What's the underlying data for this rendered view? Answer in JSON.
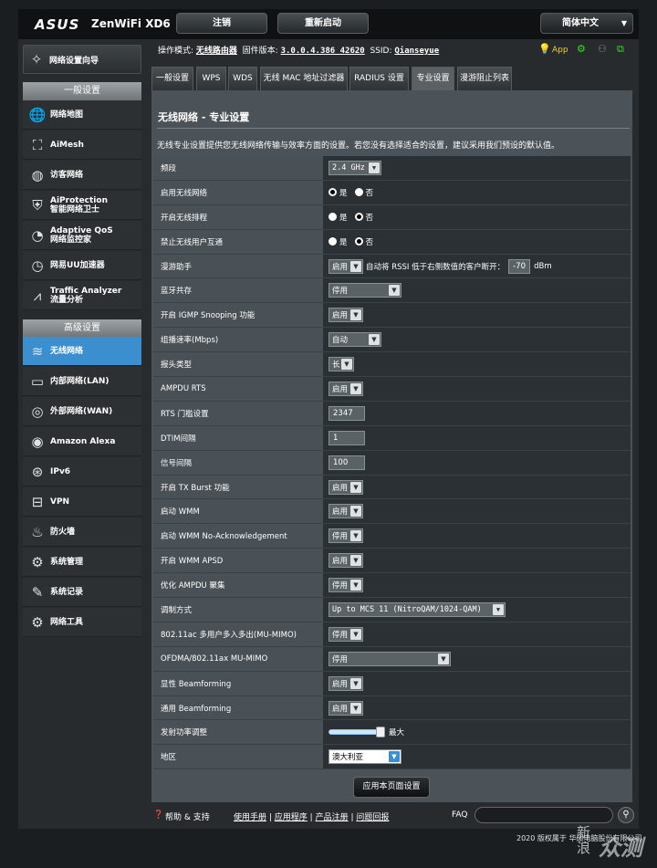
{
  "header": {
    "brand": "ASUS",
    "model": "ZenWiFi XD6",
    "logout": "注销",
    "reboot": "重新启动",
    "language": "简体中文",
    "app": "App"
  },
  "info": {
    "mode_label": "操作模式:",
    "mode": "无线路由器",
    "fw_label": "固件版本:",
    "fw": "3.0.0.4.386_42620",
    "ssid_label": "SSID:",
    "ssid": "Qianseyue"
  },
  "sidebar": {
    "wizard": "网络设置向导",
    "general_title": "一般设置",
    "general": [
      {
        "label": "网络地图",
        "icon": "globe-icon"
      },
      {
        "label": "AiMesh",
        "icon": "mesh-icon"
      },
      {
        "label": "访客网络",
        "icon": "guest-network-icon"
      },
      {
        "label": "AiProtection",
        "sub": "智能网络卫士",
        "icon": "shield-icon"
      },
      {
        "label": "Adaptive QoS",
        "sub": "网络监控家",
        "icon": "gauge-icon"
      },
      {
        "label": "网易UU加速器",
        "icon": "speed-icon"
      },
      {
        "label": "Traffic Analyzer",
        "sub": "流量分析",
        "icon": "traffic-icon"
      }
    ],
    "advanced_title": "高级设置",
    "advanced": [
      {
        "label": "无线网络",
        "icon": "wifi-icon"
      },
      {
        "label": "内部网络(LAN)",
        "icon": "lan-icon"
      },
      {
        "label": "外部网络(WAN)",
        "icon": "wan-globe-icon"
      },
      {
        "label": "Amazon Alexa",
        "icon": "alexa-icon"
      },
      {
        "label": "IPv6",
        "icon": "ipv6-icon"
      },
      {
        "label": "VPN",
        "icon": "vpn-icon"
      },
      {
        "label": "防火墙",
        "icon": "firewall-icon"
      },
      {
        "label": "系统管理",
        "icon": "admin-gear-icon"
      },
      {
        "label": "系统记录",
        "icon": "log-icon"
      },
      {
        "label": "网络工具",
        "icon": "tools-icon"
      }
    ]
  },
  "tabs": [
    "一般设置",
    "WPS",
    "WDS",
    "无线 MAC 地址过滤器",
    "RADIUS 设置",
    "专业设置",
    "漫游阻止列表"
  ],
  "page": {
    "title": "无线网络 - 专业设置",
    "desc": "无线专业设置提供您无线网络传输与效率方面的设置。若您没有选择适合的设置，建议采用我们预设的默认值。"
  },
  "radio": {
    "yes": "是",
    "no": "否"
  },
  "settings": [
    {
      "label": "频段",
      "type": "select",
      "value": "2.4 GHz",
      "mono": true,
      "w": 58
    },
    {
      "label": "启用无线网络",
      "type": "radio",
      "on": "yes"
    },
    {
      "label": "开启无线排程",
      "type": "radio",
      "on": "no"
    },
    {
      "label": "禁止无线用户互通",
      "type": "radio",
      "on": "no"
    },
    {
      "label": "漫游助手",
      "type": "roam",
      "value": "启用",
      "text": "自动将 RSSI 低于右侧数值的客户断开：",
      "rssi": "-70",
      "unit": "dBm"
    },
    {
      "label": "蓝牙共存",
      "type": "select",
      "value": "停用",
      "w": 80
    },
    {
      "label": "开启 IGMP Snooping 功能",
      "type": "select",
      "value": "启用",
      "w": 38
    },
    {
      "label": "组播速率(Mbps)",
      "type": "select",
      "value": "自动",
      "w": 58
    },
    {
      "label": "报头类型",
      "type": "select",
      "value": "长",
      "w": 28
    },
    {
      "label": "AMPDU RTS",
      "type": "select",
      "value": "启用",
      "w": 38
    },
    {
      "label": "RTS 门槛设置",
      "type": "input",
      "value": "2347"
    },
    {
      "label": "DTIM间隔",
      "type": "input",
      "value": "1"
    },
    {
      "label": "信号间隔",
      "type": "input",
      "value": "100"
    },
    {
      "label": "开启 TX Burst 功能",
      "type": "select",
      "value": "启用",
      "w": 38
    },
    {
      "label": "启动 WMM",
      "type": "select",
      "value": "启用",
      "w": 38
    },
    {
      "label": "启动 WMM No-Acknowledgement",
      "type": "select",
      "value": "停用",
      "w": 38
    },
    {
      "label": "开启 WMM APSD",
      "type": "select",
      "value": "启用",
      "w": 38
    },
    {
      "label": "优化 AMPDU 聚集",
      "type": "select",
      "value": "停用",
      "w": 38
    },
    {
      "label": "调制方式",
      "type": "select",
      "value": "Up to MCS 11 (NitroQAM/1024-QAM)",
      "mono": true,
      "w": 194
    },
    {
      "label": "802.11ac 多用户多入多出(MU-MIMO)",
      "type": "select",
      "value": "停用",
      "w": 38
    },
    {
      "label": "OFDMA/802.11ax MU-MIMO",
      "type": "select",
      "value": "停用",
      "w": 134
    },
    {
      "label": "显性 Beamforming",
      "type": "select",
      "value": "启用",
      "w": 38
    },
    {
      "label": "通用 Beamforming",
      "type": "select",
      "value": "启用",
      "w": 38
    },
    {
      "label": "发射功率调整",
      "type": "slider",
      "level": 0.95,
      "text": "最大"
    },
    {
      "label": "地区",
      "type": "select",
      "value": "澳大利亚",
      "blue": true,
      "w": 80
    }
  ],
  "apply": "应用本页面设置",
  "footer": {
    "help": "帮助 & 支持",
    "manual": "使用手册",
    "apps": "应用程序",
    "reg": "产品注册",
    "feedback": "问题回报",
    "faq": "FAQ",
    "copyright": "2020 版权属于 华硕电脑股份有限公司"
  },
  "watermark": {
    "a": "新",
    "b": "浪",
    "c": "众测"
  }
}
